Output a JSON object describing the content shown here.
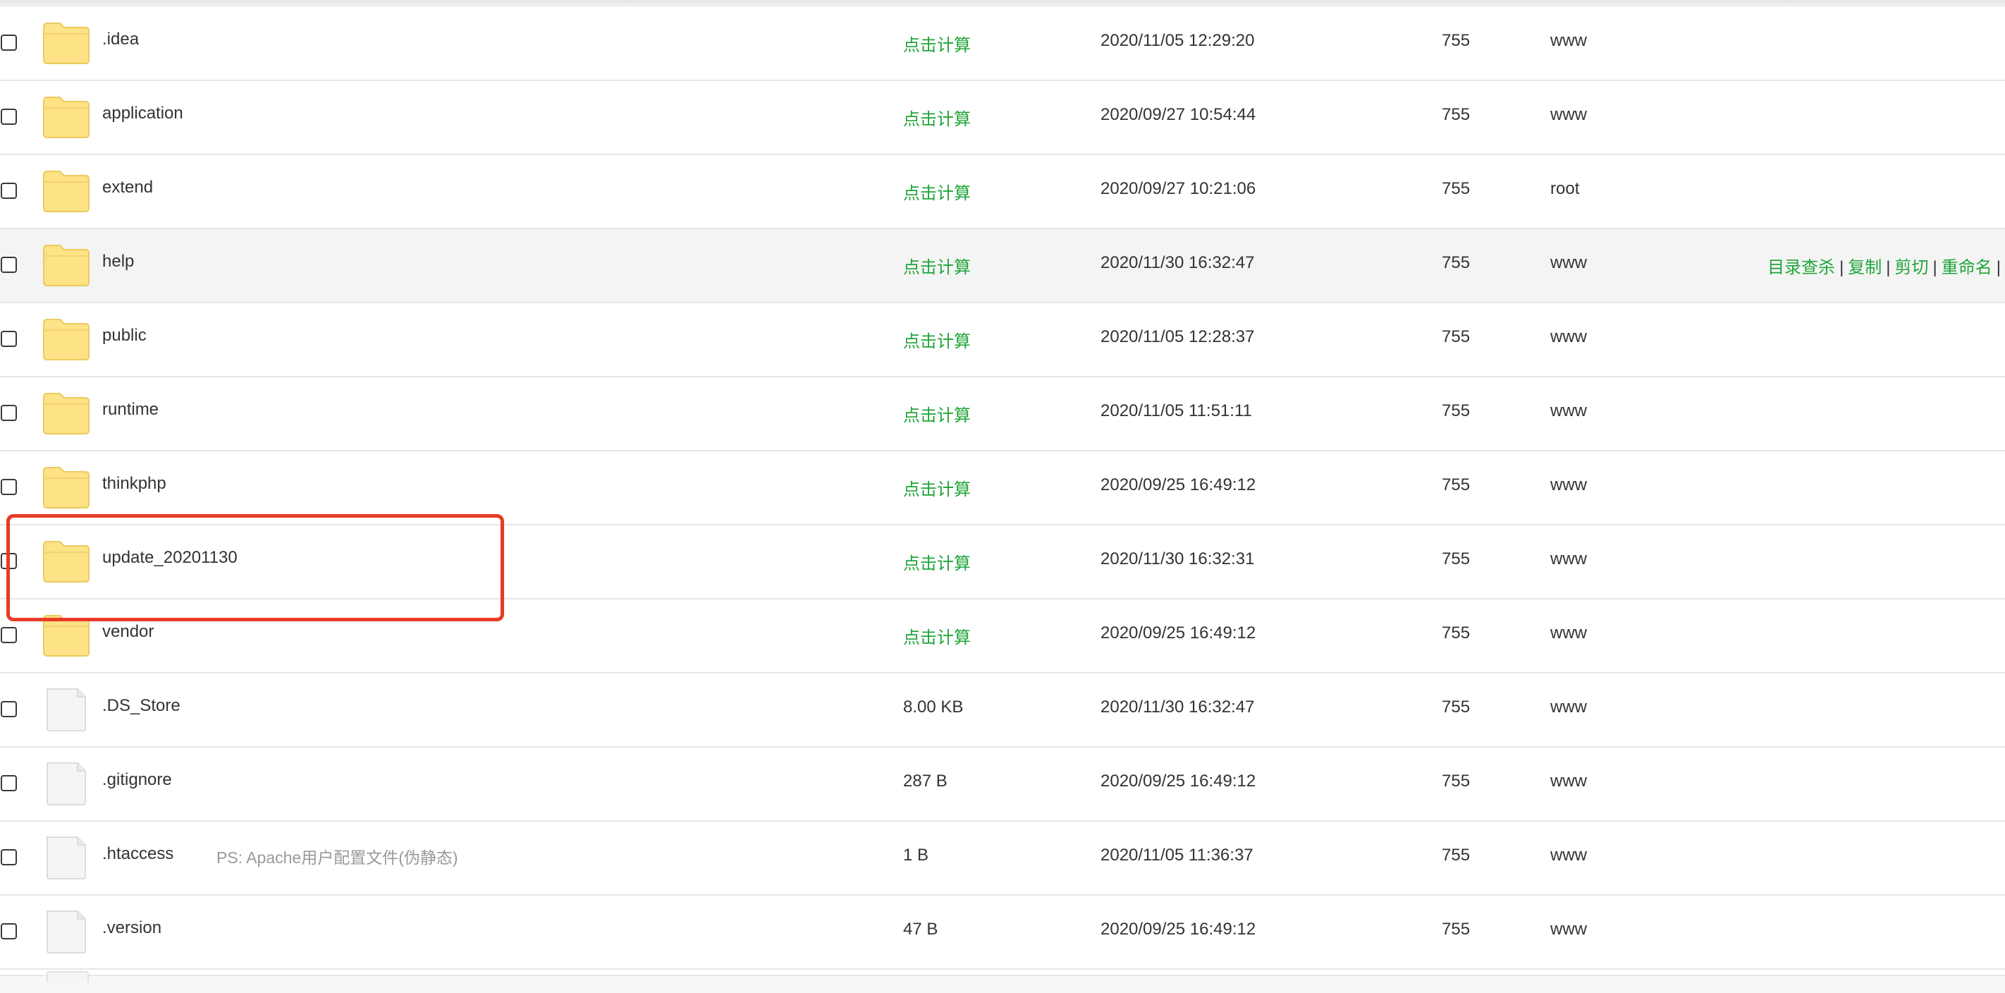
{
  "colors": {
    "accent_green": "#20a53a",
    "folder_yellow": "#fde286",
    "highlight_red": "#e83a26"
  },
  "rows": [
    {
      "type": "folder",
      "icon": "folder-icon",
      "name": ".idea",
      "note": "",
      "size": "点击计算",
      "size_is_link": true,
      "mtime": "2020/11/05 12:29:20",
      "perm": "755",
      "owner": "www"
    },
    {
      "type": "folder",
      "icon": "folder-icon",
      "name": "application",
      "note": "",
      "size": "点击计算",
      "size_is_link": true,
      "mtime": "2020/09/27 10:54:44",
      "perm": "755",
      "owner": "www"
    },
    {
      "type": "folder",
      "icon": "folder-icon",
      "name": "extend",
      "note": "",
      "size": "点击计算",
      "size_is_link": true,
      "mtime": "2020/09/27 10:21:06",
      "perm": "755",
      "owner": "root"
    },
    {
      "type": "folder",
      "icon": "folder-icon",
      "name": "help",
      "note": "",
      "size": "点击计算",
      "size_is_link": true,
      "mtime": "2020/11/30 16:32:47",
      "perm": "755",
      "owner": "www",
      "hovered": true,
      "actions": [
        "目录查杀",
        "复制",
        "剪切",
        "重命名"
      ]
    },
    {
      "type": "folder",
      "icon": "folder-icon",
      "name": "public",
      "note": "",
      "size": "点击计算",
      "size_is_link": true,
      "mtime": "2020/11/05 12:28:37",
      "perm": "755",
      "owner": "www"
    },
    {
      "type": "folder",
      "icon": "folder-icon",
      "name": "runtime",
      "note": "",
      "size": "点击计算",
      "size_is_link": true,
      "mtime": "2020/11/05 11:51:11",
      "perm": "755",
      "owner": "www"
    },
    {
      "type": "folder",
      "icon": "folder-icon",
      "name": "thinkphp",
      "note": "",
      "size": "点击计算",
      "size_is_link": true,
      "mtime": "2020/09/25 16:49:12",
      "perm": "755",
      "owner": "www"
    },
    {
      "type": "folder",
      "icon": "folder-icon",
      "name": "update_20201130",
      "note": "",
      "size": "点击计算",
      "size_is_link": true,
      "mtime": "2020/11/30 16:32:31",
      "perm": "755",
      "owner": "www",
      "highlighted": true
    },
    {
      "type": "folder",
      "icon": "folder-icon",
      "name": "vendor",
      "note": "",
      "size": "点击计算",
      "size_is_link": true,
      "mtime": "2020/09/25 16:49:12",
      "perm": "755",
      "owner": "www"
    },
    {
      "type": "file",
      "icon": "file-icon",
      "name": ".DS_Store",
      "note": "",
      "size": "8.00 KB",
      "size_is_link": false,
      "mtime": "2020/11/30 16:32:47",
      "perm": "755",
      "owner": "www"
    },
    {
      "type": "file",
      "icon": "file-icon",
      "name": ".gitignore",
      "note": "",
      "size": "287 B",
      "size_is_link": false,
      "mtime": "2020/09/25 16:49:12",
      "perm": "755",
      "owner": "www"
    },
    {
      "type": "file",
      "icon": "file-icon",
      "name": ".htaccess",
      "note": "PS: Apache用户配置文件(伪静态)",
      "size": "1 B",
      "size_is_link": false,
      "mtime": "2020/11/05 11:36:37",
      "perm": "755",
      "owner": "www"
    },
    {
      "type": "file",
      "icon": "file-icon",
      "name": ".version",
      "note": "",
      "size": "47 B",
      "size_is_link": false,
      "mtime": "2020/09/25 16:49:12",
      "perm": "755",
      "owner": "www"
    }
  ]
}
